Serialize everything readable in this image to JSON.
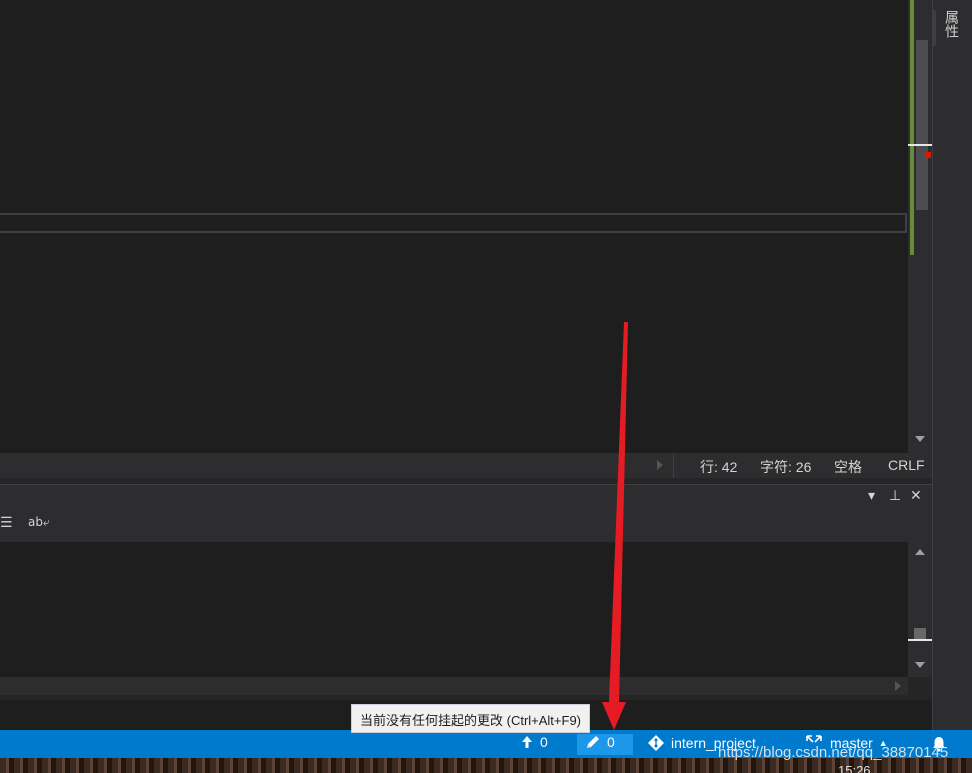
{
  "right_panel": {
    "properties_tab": "属性"
  },
  "editor_status": {
    "line": "行: 42",
    "char": "字符: 26",
    "indent": "空格",
    "line_ending": "CRLF"
  },
  "panel": {
    "dropdown_glyph": "▾",
    "pin_glyph": "⊥",
    "close_glyph": "✕",
    "toolbar_list_glyph": "☰",
    "toolbar_wrap_glyph": "ab⤶"
  },
  "tooltip": {
    "text": "当前没有任何挂起的更改 (Ctrl+Alt+F9)"
  },
  "statusbar": {
    "push_count": "0",
    "pending_changes_count": "0",
    "repo_name": "intern_project",
    "branch_name": "master",
    "branch_caret": "▲"
  },
  "watermark": "https://blog.csdn.net/qq_38870145",
  "clock": "15:26",
  "colors": {
    "accent": "#007acc",
    "annotation_arrow": "#e51c23",
    "editor_bg": "#1e1e1e"
  }
}
